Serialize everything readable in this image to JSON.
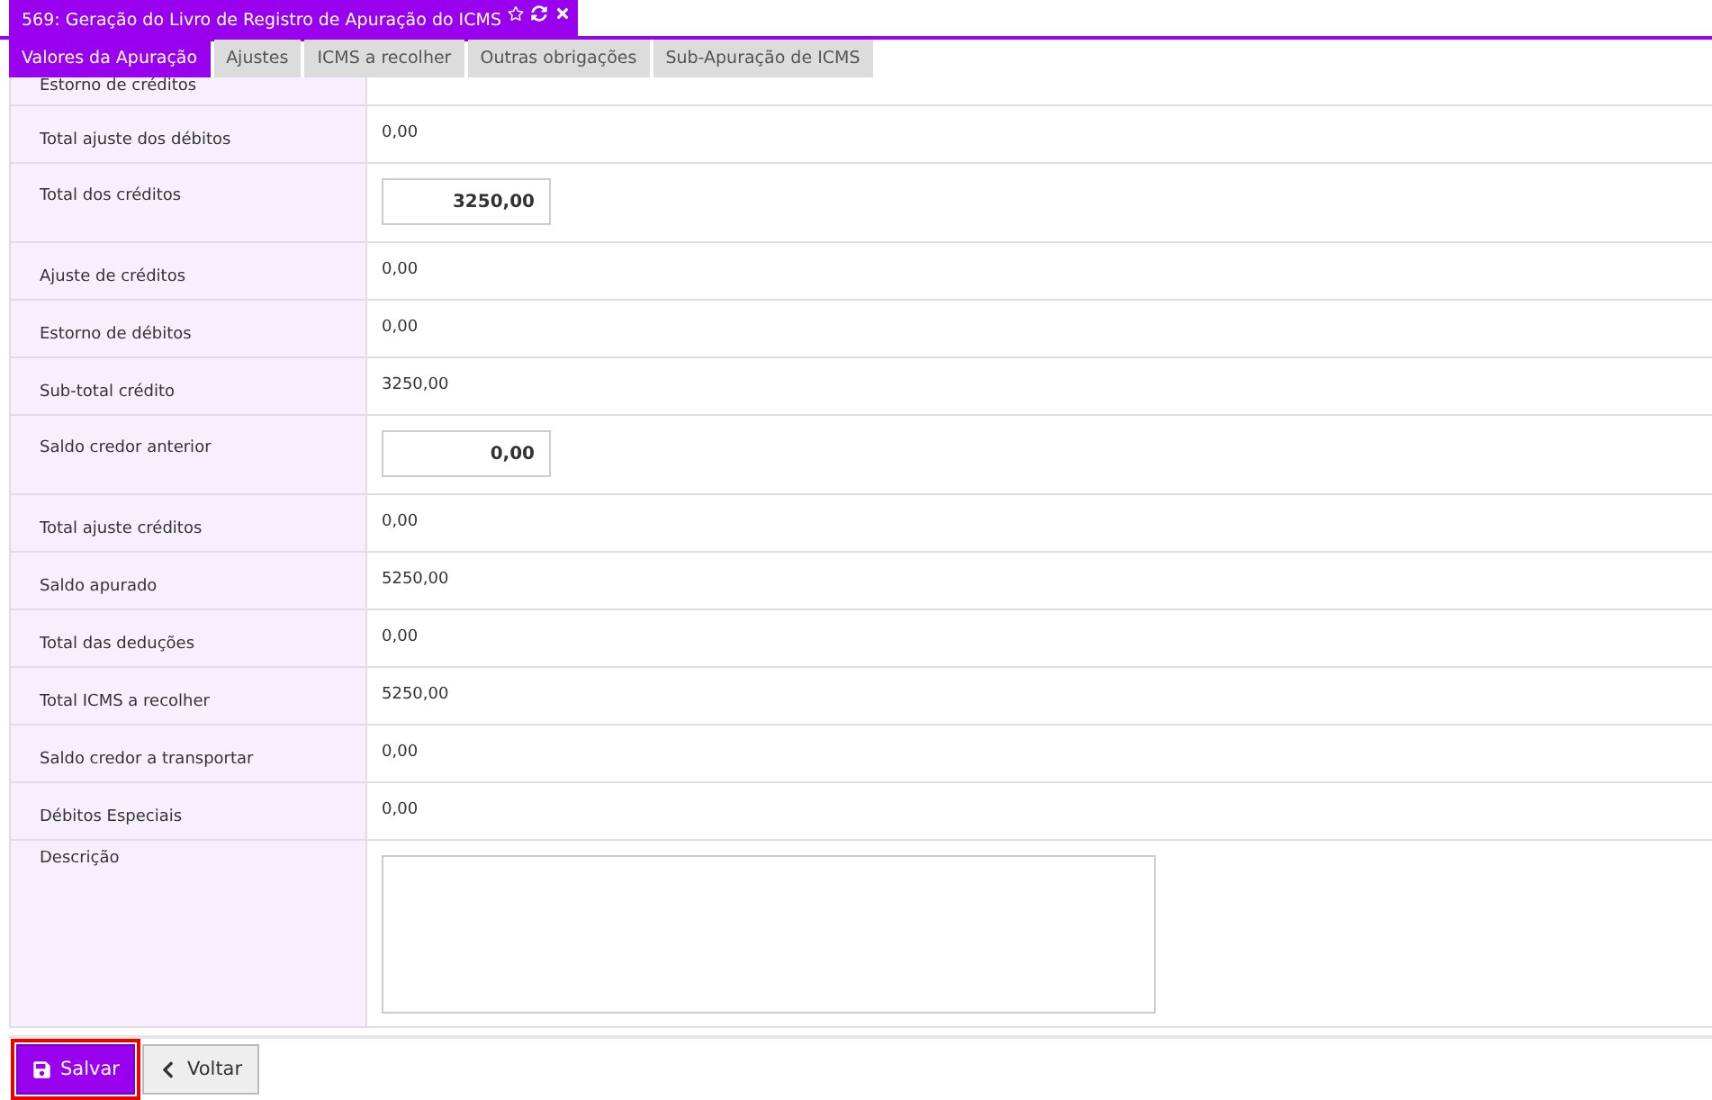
{
  "window": {
    "title": "569: Geração do Livro de Registro de Apuração do ICMS"
  },
  "tabs": [
    {
      "label": "Valores da Apuração",
      "selected": true
    },
    {
      "label": "Ajustes",
      "selected": false
    },
    {
      "label": "ICMS a recolher",
      "selected": false
    },
    {
      "label": "Outras obrigações",
      "selected": false
    },
    {
      "label": "Sub-Apuração de ICMS",
      "selected": false
    }
  ],
  "rows": [
    {
      "kind": "cut",
      "label": "Estorno de créditos"
    },
    {
      "kind": "text",
      "label": "Total ajuste dos débitos",
      "value": "0,00"
    },
    {
      "kind": "input",
      "label": "Total dos créditos",
      "value": "3250,00"
    },
    {
      "kind": "text",
      "label": "Ajuste de créditos",
      "value": "0,00"
    },
    {
      "kind": "text",
      "label": "Estorno de débitos",
      "value": "0,00"
    },
    {
      "kind": "text",
      "label": "Sub-total crédito",
      "value": "3250,00"
    },
    {
      "kind": "input",
      "label": "Saldo credor anterior",
      "value": "0,00"
    },
    {
      "kind": "text",
      "label": "Total ajuste créditos",
      "value": "0,00"
    },
    {
      "kind": "text",
      "label": "Saldo apurado",
      "value": "5250,00"
    },
    {
      "kind": "text",
      "label": "Total das deduções",
      "value": "0,00"
    },
    {
      "kind": "text",
      "label": "Total ICMS a recolher",
      "value": "5250,00"
    },
    {
      "kind": "text",
      "label": "Saldo credor a transportar",
      "value": "0,00"
    },
    {
      "kind": "text",
      "label": "Débitos Especiais",
      "value": "0,00"
    },
    {
      "kind": "textarea",
      "label": "Descrição",
      "value": ""
    }
  ],
  "buttons": [
    {
      "kind": "save",
      "label": "Salvar"
    },
    {
      "kind": "back",
      "label": "Voltar"
    }
  ]
}
